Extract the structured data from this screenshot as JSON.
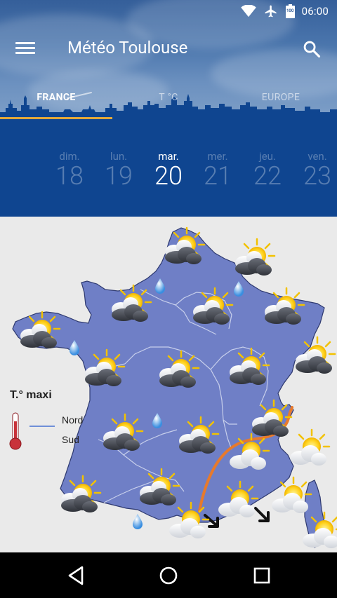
{
  "status_bar": {
    "time": "06:00",
    "battery_label": "100",
    "icons": [
      "wifi-icon",
      "airplane-icon",
      "battery-icon"
    ]
  },
  "app_bar": {
    "title": "Météo Toulouse",
    "menu_icon": "menu-icon",
    "search_icon": "search-icon"
  },
  "tabs": [
    {
      "label": "FRANCE",
      "active": true
    },
    {
      "label": "T °C",
      "active": false
    },
    {
      "label": "EUROPE",
      "active": false
    }
  ],
  "days": [
    {
      "name": "dim.",
      "num": "18",
      "active": false
    },
    {
      "name": "lun.",
      "num": "19",
      "active": false
    },
    {
      "name": "mar.",
      "num": "20",
      "active": true
    },
    {
      "name": "mer.",
      "num": "21",
      "active": false
    },
    {
      "name": "jeu.",
      "num": "22",
      "active": false
    },
    {
      "name": "ven.",
      "num": "23",
      "active": false
    }
  ],
  "map": {
    "legend_title": "T.° maxi",
    "legend_north": "Nord",
    "legend_south": "Sud",
    "colors": {
      "land": "#6f7fc6",
      "sea": "#eaeaea",
      "front_line": "#e77a2c",
      "legend_line": "#6f8fd8",
      "thermometer": "#c8323a"
    }
  },
  "colors": {
    "header_top": "#355f9a",
    "day_strip": "#0f4590",
    "tab_indicator": "#e3a83a"
  },
  "nav": [
    "back-icon",
    "home-icon",
    "recents-icon"
  ]
}
